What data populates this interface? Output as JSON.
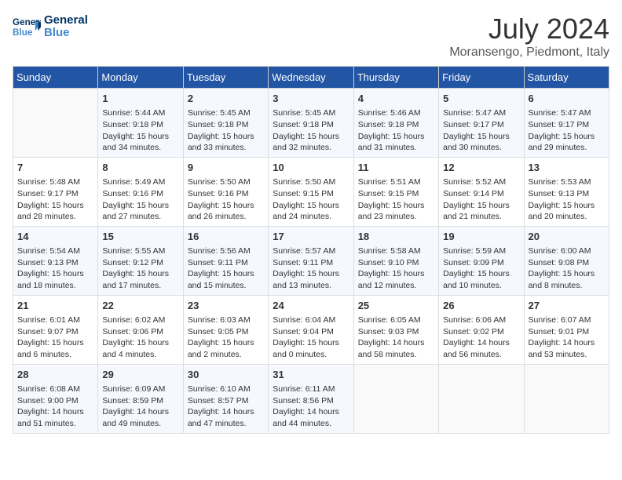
{
  "header": {
    "logo_line1": "General",
    "logo_line2": "Blue",
    "month": "July 2024",
    "location": "Moransengo, Piedmont, Italy"
  },
  "weekdays": [
    "Sunday",
    "Monday",
    "Tuesday",
    "Wednesday",
    "Thursday",
    "Friday",
    "Saturday"
  ],
  "weeks": [
    [
      {
        "day": "",
        "sunrise": "",
        "sunset": "",
        "daylight": ""
      },
      {
        "day": "1",
        "sunrise": "Sunrise: 5:44 AM",
        "sunset": "Sunset: 9:18 PM",
        "daylight": "Daylight: 15 hours and 34 minutes."
      },
      {
        "day": "2",
        "sunrise": "Sunrise: 5:45 AM",
        "sunset": "Sunset: 9:18 PM",
        "daylight": "Daylight: 15 hours and 33 minutes."
      },
      {
        "day": "3",
        "sunrise": "Sunrise: 5:45 AM",
        "sunset": "Sunset: 9:18 PM",
        "daylight": "Daylight: 15 hours and 32 minutes."
      },
      {
        "day": "4",
        "sunrise": "Sunrise: 5:46 AM",
        "sunset": "Sunset: 9:18 PM",
        "daylight": "Daylight: 15 hours and 31 minutes."
      },
      {
        "day": "5",
        "sunrise": "Sunrise: 5:47 AM",
        "sunset": "Sunset: 9:17 PM",
        "daylight": "Daylight: 15 hours and 30 minutes."
      },
      {
        "day": "6",
        "sunrise": "Sunrise: 5:47 AM",
        "sunset": "Sunset: 9:17 PM",
        "daylight": "Daylight: 15 hours and 29 minutes."
      }
    ],
    [
      {
        "day": "7",
        "sunrise": "Sunrise: 5:48 AM",
        "sunset": "Sunset: 9:17 PM",
        "daylight": "Daylight: 15 hours and 28 minutes."
      },
      {
        "day": "8",
        "sunrise": "Sunrise: 5:49 AM",
        "sunset": "Sunset: 9:16 PM",
        "daylight": "Daylight: 15 hours and 27 minutes."
      },
      {
        "day": "9",
        "sunrise": "Sunrise: 5:50 AM",
        "sunset": "Sunset: 9:16 PM",
        "daylight": "Daylight: 15 hours and 26 minutes."
      },
      {
        "day": "10",
        "sunrise": "Sunrise: 5:50 AM",
        "sunset": "Sunset: 9:15 PM",
        "daylight": "Daylight: 15 hours and 24 minutes."
      },
      {
        "day": "11",
        "sunrise": "Sunrise: 5:51 AM",
        "sunset": "Sunset: 9:15 PM",
        "daylight": "Daylight: 15 hours and 23 minutes."
      },
      {
        "day": "12",
        "sunrise": "Sunrise: 5:52 AM",
        "sunset": "Sunset: 9:14 PM",
        "daylight": "Daylight: 15 hours and 21 minutes."
      },
      {
        "day": "13",
        "sunrise": "Sunrise: 5:53 AM",
        "sunset": "Sunset: 9:13 PM",
        "daylight": "Daylight: 15 hours and 20 minutes."
      }
    ],
    [
      {
        "day": "14",
        "sunrise": "Sunrise: 5:54 AM",
        "sunset": "Sunset: 9:13 PM",
        "daylight": "Daylight: 15 hours and 18 minutes."
      },
      {
        "day": "15",
        "sunrise": "Sunrise: 5:55 AM",
        "sunset": "Sunset: 9:12 PM",
        "daylight": "Daylight: 15 hours and 17 minutes."
      },
      {
        "day": "16",
        "sunrise": "Sunrise: 5:56 AM",
        "sunset": "Sunset: 9:11 PM",
        "daylight": "Daylight: 15 hours and 15 minutes."
      },
      {
        "day": "17",
        "sunrise": "Sunrise: 5:57 AM",
        "sunset": "Sunset: 9:11 PM",
        "daylight": "Daylight: 15 hours and 13 minutes."
      },
      {
        "day": "18",
        "sunrise": "Sunrise: 5:58 AM",
        "sunset": "Sunset: 9:10 PM",
        "daylight": "Daylight: 15 hours and 12 minutes."
      },
      {
        "day": "19",
        "sunrise": "Sunrise: 5:59 AM",
        "sunset": "Sunset: 9:09 PM",
        "daylight": "Daylight: 15 hours and 10 minutes."
      },
      {
        "day": "20",
        "sunrise": "Sunrise: 6:00 AM",
        "sunset": "Sunset: 9:08 PM",
        "daylight": "Daylight: 15 hours and 8 minutes."
      }
    ],
    [
      {
        "day": "21",
        "sunrise": "Sunrise: 6:01 AM",
        "sunset": "Sunset: 9:07 PM",
        "daylight": "Daylight: 15 hours and 6 minutes."
      },
      {
        "day": "22",
        "sunrise": "Sunrise: 6:02 AM",
        "sunset": "Sunset: 9:06 PM",
        "daylight": "Daylight: 15 hours and 4 minutes."
      },
      {
        "day": "23",
        "sunrise": "Sunrise: 6:03 AM",
        "sunset": "Sunset: 9:05 PM",
        "daylight": "Daylight: 15 hours and 2 minutes."
      },
      {
        "day": "24",
        "sunrise": "Sunrise: 6:04 AM",
        "sunset": "Sunset: 9:04 PM",
        "daylight": "Daylight: 15 hours and 0 minutes."
      },
      {
        "day": "25",
        "sunrise": "Sunrise: 6:05 AM",
        "sunset": "Sunset: 9:03 PM",
        "daylight": "Daylight: 14 hours and 58 minutes."
      },
      {
        "day": "26",
        "sunrise": "Sunrise: 6:06 AM",
        "sunset": "Sunset: 9:02 PM",
        "daylight": "Daylight: 14 hours and 56 minutes."
      },
      {
        "day": "27",
        "sunrise": "Sunrise: 6:07 AM",
        "sunset": "Sunset: 9:01 PM",
        "daylight": "Daylight: 14 hours and 53 minutes."
      }
    ],
    [
      {
        "day": "28",
        "sunrise": "Sunrise: 6:08 AM",
        "sunset": "Sunset: 9:00 PM",
        "daylight": "Daylight: 14 hours and 51 minutes."
      },
      {
        "day": "29",
        "sunrise": "Sunrise: 6:09 AM",
        "sunset": "Sunset: 8:59 PM",
        "daylight": "Daylight: 14 hours and 49 minutes."
      },
      {
        "day": "30",
        "sunrise": "Sunrise: 6:10 AM",
        "sunset": "Sunset: 8:57 PM",
        "daylight": "Daylight: 14 hours and 47 minutes."
      },
      {
        "day": "31",
        "sunrise": "Sunrise: 6:11 AM",
        "sunset": "Sunset: 8:56 PM",
        "daylight": "Daylight: 14 hours and 44 minutes."
      },
      {
        "day": "",
        "sunrise": "",
        "sunset": "",
        "daylight": ""
      },
      {
        "day": "",
        "sunrise": "",
        "sunset": "",
        "daylight": ""
      },
      {
        "day": "",
        "sunrise": "",
        "sunset": "",
        "daylight": ""
      }
    ]
  ]
}
